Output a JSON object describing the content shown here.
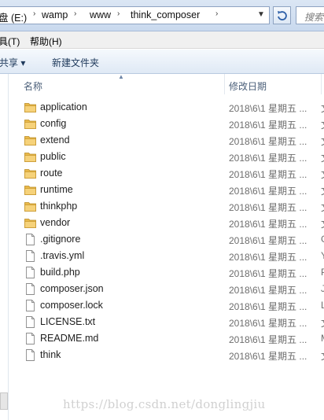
{
  "address_bar": {
    "crumbs": [
      "盘 (E:)",
      "wamp",
      "www",
      "think_composer"
    ],
    "search_placeholder": "搜索"
  },
  "menu": {
    "items": [
      "具(T)",
      "帮助(H)"
    ]
  },
  "toolbar": {
    "share_label": "共享 ▾",
    "new_folder_label": "新建文件夹"
  },
  "columns": {
    "name": "名称",
    "date_modified": "修改日期"
  },
  "files": [
    {
      "name": "application",
      "date": "2018\\6\\1 星期五 ...",
      "extra": "文",
      "type": "folder"
    },
    {
      "name": "config",
      "date": "2018\\6\\1 星期五 ...",
      "extra": "文",
      "type": "folder"
    },
    {
      "name": "extend",
      "date": "2018\\6\\1 星期五 ...",
      "extra": "文",
      "type": "folder"
    },
    {
      "name": "public",
      "date": "2018\\6\\1 星期五 ...",
      "extra": "文",
      "type": "folder"
    },
    {
      "name": "route",
      "date": "2018\\6\\1 星期五 ...",
      "extra": "文",
      "type": "folder"
    },
    {
      "name": "runtime",
      "date": "2018\\6\\1 星期五 ...",
      "extra": "文",
      "type": "folder"
    },
    {
      "name": "thinkphp",
      "date": "2018\\6\\1 星期五 ...",
      "extra": "文",
      "type": "folder"
    },
    {
      "name": "vendor",
      "date": "2018\\6\\1 星期五 ...",
      "extra": "文",
      "type": "folder"
    },
    {
      "name": ".gitignore",
      "date": "2018\\6\\1 星期五 ...",
      "extra": "G",
      "type": "file"
    },
    {
      "name": ".travis.yml",
      "date": "2018\\6\\1 星期五 ...",
      "extra": "Y",
      "type": "file"
    },
    {
      "name": "build.php",
      "date": "2018\\6\\1 星期五 ...",
      "extra": "P",
      "type": "file"
    },
    {
      "name": "composer.json",
      "date": "2018\\6\\1 星期五 ...",
      "extra": "J",
      "type": "file"
    },
    {
      "name": "composer.lock",
      "date": "2018\\6\\1 星期五 ...",
      "extra": "L",
      "type": "file"
    },
    {
      "name": "LICENSE.txt",
      "date": "2018\\6\\1 星期五 ...",
      "extra": "文",
      "type": "file"
    },
    {
      "name": "README.md",
      "date": "2018\\6\\1 星期五 ...",
      "extra": "M",
      "type": "file"
    },
    {
      "name": "think",
      "date": "2018\\6\\1 星期五 ...",
      "extra": "文",
      "type": "file"
    }
  ],
  "watermark": "https://blog.csdn.net/donglingjiu"
}
